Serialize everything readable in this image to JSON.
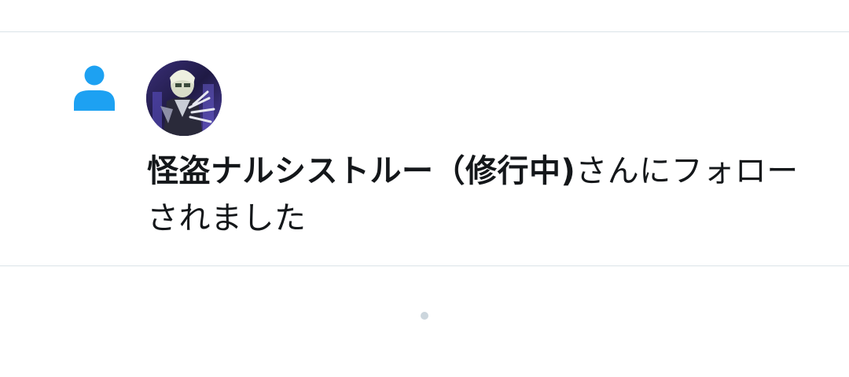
{
  "notification": {
    "type_icon": "person-icon",
    "avatar_icon": "user-avatar",
    "user_name": "怪盗ナルシストルー（修行中)",
    "action_text": "さんにフォローされました"
  },
  "colors": {
    "accent": "#1da1f2",
    "text": "#14171a",
    "divider": "#dbe3e8",
    "loading_dot": "#ccd6dd"
  },
  "loading_indicator": "dot"
}
